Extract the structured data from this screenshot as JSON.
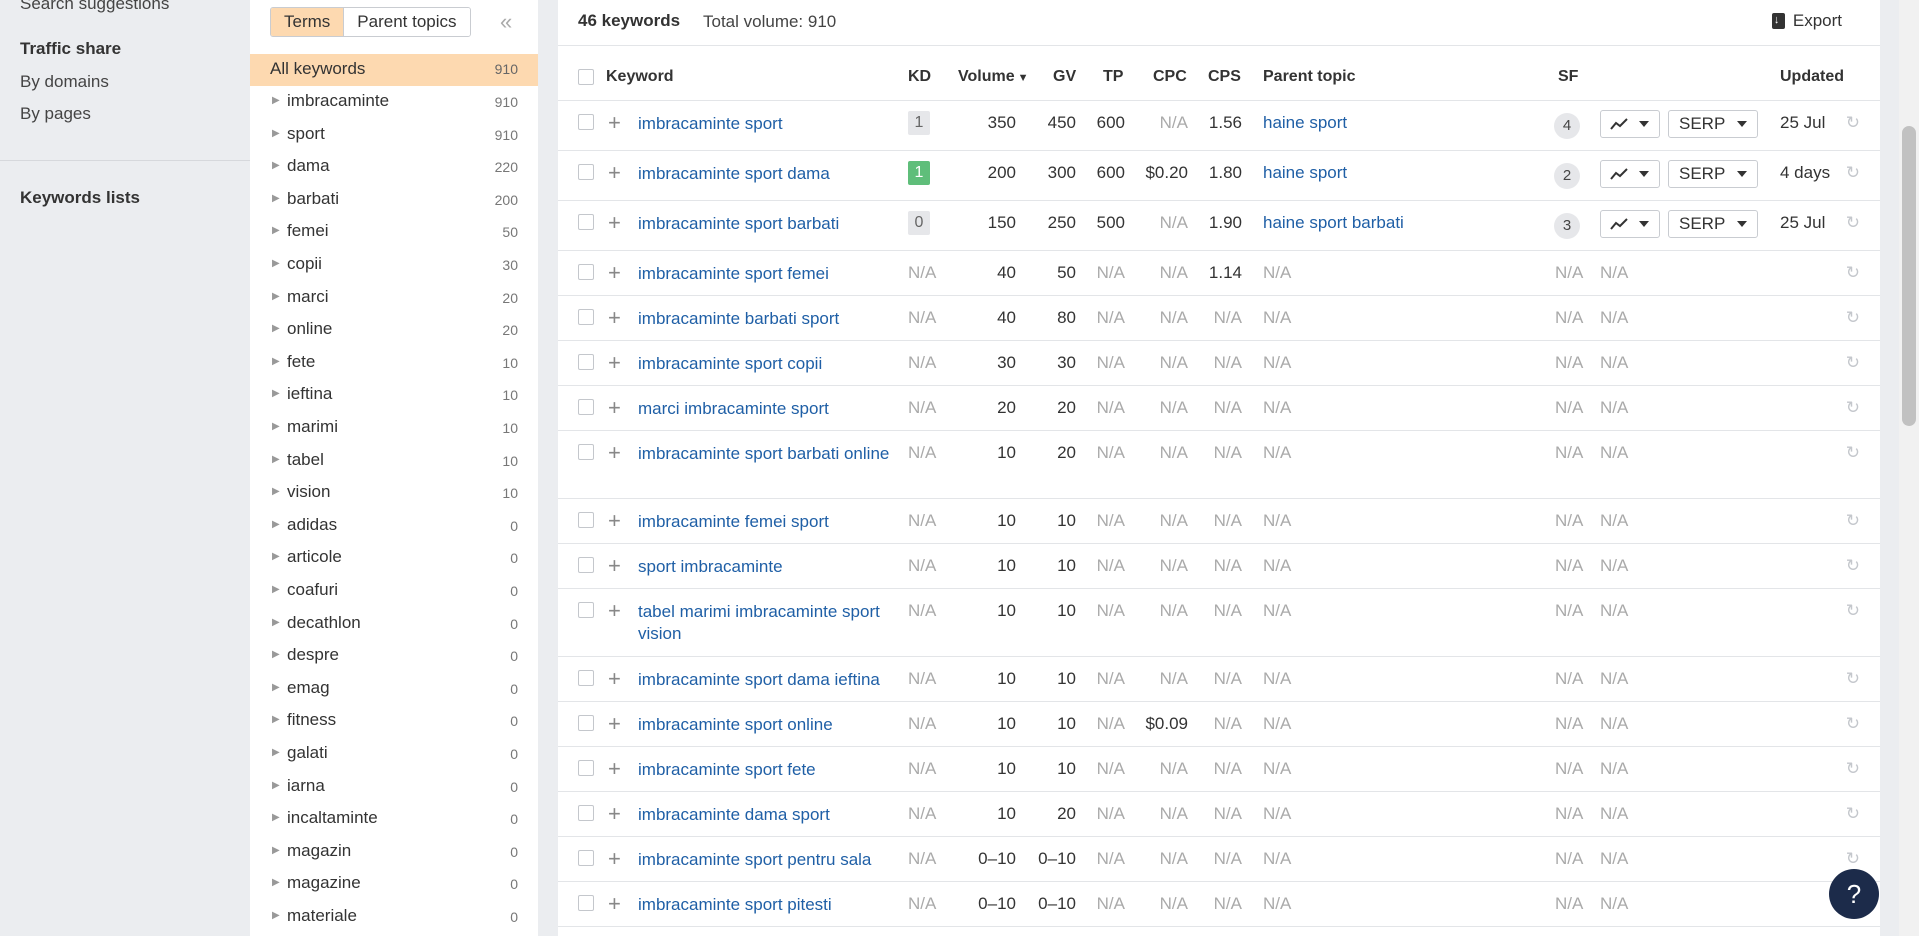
{
  "leftnav": {
    "search_suggestions": "Search suggestions",
    "traffic_share": "Traffic share",
    "by_domains": "By domains",
    "by_pages": "By pages",
    "keywords_lists": "Keywords lists"
  },
  "terms_panel": {
    "tabs": [
      "Terms",
      "Parent topics"
    ],
    "all_keywords": {
      "label": "All keywords",
      "count": "910"
    },
    "terms": [
      {
        "label": "imbracaminte",
        "count": "910"
      },
      {
        "label": "sport",
        "count": "910"
      },
      {
        "label": "dama",
        "count": "220"
      },
      {
        "label": "barbati",
        "count": "200"
      },
      {
        "label": "femei",
        "count": "50"
      },
      {
        "label": "copii",
        "count": "30"
      },
      {
        "label": "marci",
        "count": "20"
      },
      {
        "label": "online",
        "count": "20"
      },
      {
        "label": "fete",
        "count": "10"
      },
      {
        "label": "ieftina",
        "count": "10"
      },
      {
        "label": "marimi",
        "count": "10"
      },
      {
        "label": "tabel",
        "count": "10"
      },
      {
        "label": "vision",
        "count": "10"
      },
      {
        "label": "adidas",
        "count": "0"
      },
      {
        "label": "articole",
        "count": "0"
      },
      {
        "label": "coafuri",
        "count": "0"
      },
      {
        "label": "decathlon",
        "count": "0"
      },
      {
        "label": "despre",
        "count": "0"
      },
      {
        "label": "emag",
        "count": "0"
      },
      {
        "label": "fitness",
        "count": "0"
      },
      {
        "label": "galati",
        "count": "0"
      },
      {
        "label": "iarna",
        "count": "0"
      },
      {
        "label": "incaltaminte",
        "count": "0"
      },
      {
        "label": "magazin",
        "count": "0"
      },
      {
        "label": "magazine",
        "count": "0"
      },
      {
        "label": "materiale",
        "count": "0"
      }
    ]
  },
  "main": {
    "keyword_count": "46 keywords",
    "total_volume": "Total volume: 910",
    "export_label": "Export",
    "columns": {
      "keyword": "Keyword",
      "kd": "KD",
      "volume": "Volume",
      "gv": "GV",
      "tp": "TP",
      "cpc": "CPC",
      "cps": "CPS",
      "parent_topic": "Parent topic",
      "sf": "SF",
      "updated": "Updated"
    },
    "rows": [
      {
        "keyword": "imbracaminte sport",
        "kd": "1",
        "kd_style": "grey",
        "volume": "350",
        "gv": "450",
        "tp": "600",
        "cpc": "N/A",
        "cps": "1.56",
        "parent": "haine sport",
        "sf": "4",
        "serp": "SERP",
        "updated": "25 Jul"
      },
      {
        "keyword": "imbracaminte sport dama",
        "kd": "1",
        "kd_style": "green",
        "volume": "200",
        "gv": "300",
        "tp": "600",
        "cpc": "$0.20",
        "cps": "1.80",
        "parent": "haine sport",
        "sf": "2",
        "serp": "SERP",
        "updated": "4 days"
      },
      {
        "keyword": "imbracaminte sport barbati",
        "kd": "0",
        "kd_style": "grey",
        "volume": "150",
        "gv": "250",
        "tp": "500",
        "cpc": "N/A",
        "cps": "1.90",
        "parent": "haine sport barbati",
        "sf": "3",
        "serp": "SERP",
        "updated": "25 Jul"
      },
      {
        "keyword": "imbracaminte sport femei",
        "kd": "N/A",
        "volume": "40",
        "gv": "50",
        "tp": "N/A",
        "cpc": "N/A",
        "cps": "1.14",
        "parent": "N/A",
        "sf": "N/A",
        "trend": "N/A"
      },
      {
        "keyword": "imbracaminte barbati sport",
        "kd": "N/A",
        "volume": "40",
        "gv": "80",
        "tp": "N/A",
        "cpc": "N/A",
        "cps": "N/A",
        "parent": "N/A",
        "sf": "N/A",
        "trend": "N/A"
      },
      {
        "keyword": "imbracaminte sport copii",
        "kd": "N/A",
        "volume": "30",
        "gv": "30",
        "tp": "N/A",
        "cpc": "N/A",
        "cps": "N/A",
        "parent": "N/A",
        "sf": "N/A",
        "trend": "N/A"
      },
      {
        "keyword": "marci imbracaminte sport",
        "kd": "N/A",
        "volume": "20",
        "gv": "20",
        "tp": "N/A",
        "cpc": "N/A",
        "cps": "N/A",
        "parent": "N/A",
        "sf": "N/A",
        "trend": "N/A"
      },
      {
        "keyword": "imbracaminte sport barbati online",
        "kd": "N/A",
        "volume": "10",
        "gv": "20",
        "tp": "N/A",
        "cpc": "N/A",
        "cps": "N/A",
        "parent": "N/A",
        "sf": "N/A",
        "trend": "N/A",
        "tall": true
      },
      {
        "keyword": "imbracaminte femei sport",
        "kd": "N/A",
        "volume": "10",
        "gv": "10",
        "tp": "N/A",
        "cpc": "N/A",
        "cps": "N/A",
        "parent": "N/A",
        "sf": "N/A",
        "trend": "N/A"
      },
      {
        "keyword": "sport imbracaminte",
        "kd": "N/A",
        "volume": "10",
        "gv": "10",
        "tp": "N/A",
        "cpc": "N/A",
        "cps": "N/A",
        "parent": "N/A",
        "sf": "N/A",
        "trend": "N/A"
      },
      {
        "keyword": "tabel marimi imbracaminte sport vision",
        "kd": "N/A",
        "volume": "10",
        "gv": "10",
        "tp": "N/A",
        "cpc": "N/A",
        "cps": "N/A",
        "parent": "N/A",
        "sf": "N/A",
        "trend": "N/A",
        "tall": true
      },
      {
        "keyword": "imbracaminte sport dama ieftina",
        "kd": "N/A",
        "volume": "10",
        "gv": "10",
        "tp": "N/A",
        "cpc": "N/A",
        "cps": "N/A",
        "parent": "N/A",
        "sf": "N/A",
        "trend": "N/A"
      },
      {
        "keyword": "imbracaminte sport online",
        "kd": "N/A",
        "volume": "10",
        "gv": "10",
        "tp": "N/A",
        "cpc": "$0.09",
        "cps": "N/A",
        "parent": "N/A",
        "sf": "N/A",
        "trend": "N/A"
      },
      {
        "keyword": "imbracaminte sport fete",
        "kd": "N/A",
        "volume": "10",
        "gv": "10",
        "tp": "N/A",
        "cpc": "N/A",
        "cps": "N/A",
        "parent": "N/A",
        "sf": "N/A",
        "trend": "N/A"
      },
      {
        "keyword": "imbracaminte dama sport",
        "kd": "N/A",
        "volume": "10",
        "gv": "20",
        "tp": "N/A",
        "cpc": "N/A",
        "cps": "N/A",
        "parent": "N/A",
        "sf": "N/A",
        "trend": "N/A"
      },
      {
        "keyword": "imbracaminte sport pentru sala",
        "kd": "N/A",
        "volume": "0–10",
        "gv": "0–10",
        "tp": "N/A",
        "cpc": "N/A",
        "cps": "N/A",
        "parent": "N/A",
        "sf": "N/A",
        "trend": "N/A"
      },
      {
        "keyword": "imbracaminte sport pitesti",
        "kd": "N/A",
        "volume": "0–10",
        "gv": "0–10",
        "tp": "N/A",
        "cpc": "N/A",
        "cps": "N/A",
        "parent": "N/A",
        "sf": "N/A",
        "trend": "N/A"
      }
    ]
  },
  "help_label": "?",
  "colors": {
    "accent": "#fdd9b0",
    "link": "#1f5fa6",
    "kd_green": "#5fbe7a"
  }
}
